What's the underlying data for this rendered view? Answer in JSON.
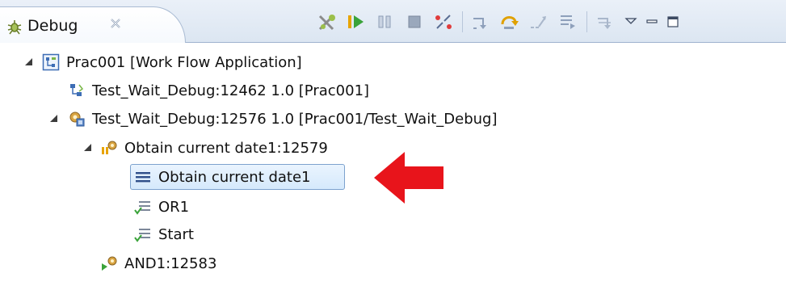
{
  "view": {
    "tab_title": "Debug",
    "close_icon": "close-icon",
    "view_icon": "debug-view-icon"
  },
  "toolbar": {
    "buttons": [
      {
        "icon": "remove-terminated-icon"
      },
      {
        "icon": "resume-icon"
      },
      {
        "icon": "suspend-icon"
      },
      {
        "icon": "terminate-icon"
      },
      {
        "icon": "disconnect-icon"
      },
      {
        "icon": "step-into-icon"
      },
      {
        "icon": "step-over-icon"
      },
      {
        "icon": "step-return-icon"
      },
      {
        "icon": "drop-to-frame-icon"
      },
      {
        "icon": "step-filters-icon"
      },
      {
        "icon": "view-menu-icon"
      },
      {
        "icon": "minimize-icon"
      },
      {
        "icon": "maximize-icon"
      }
    ]
  },
  "tree": {
    "items": [
      {
        "label": "Prac001 [Work Flow Application]",
        "icon": "launch-config-icon",
        "expanded": true
      },
      {
        "label": "Test_Wait_Debug:12462 1.0 [Prac001]",
        "icon": "process-icon"
      },
      {
        "label": "Test_Wait_Debug:12576 1.0 [Prac001/Test_Wait_Debug]",
        "icon": "debug-target-icon",
        "expanded": true
      },
      {
        "label": "Obtain current date1:12579",
        "icon": "thread-suspended-icon",
        "expanded": true
      },
      {
        "label": "Obtain current date1",
        "icon": "stack-frame-icon",
        "selected": true
      },
      {
        "label": "OR1",
        "icon": "stack-frame-done-icon"
      },
      {
        "label": "Start",
        "icon": "stack-frame-done-icon"
      },
      {
        "label": "AND1:12583",
        "icon": "thread-running-icon"
      }
    ]
  },
  "annotation": {
    "icon": "red-arrow-icon",
    "color": "#e8141b"
  },
  "colors": {
    "selection": "#d5e9fc",
    "selection_border": "#7da2ce",
    "header": "#dce6f2"
  }
}
